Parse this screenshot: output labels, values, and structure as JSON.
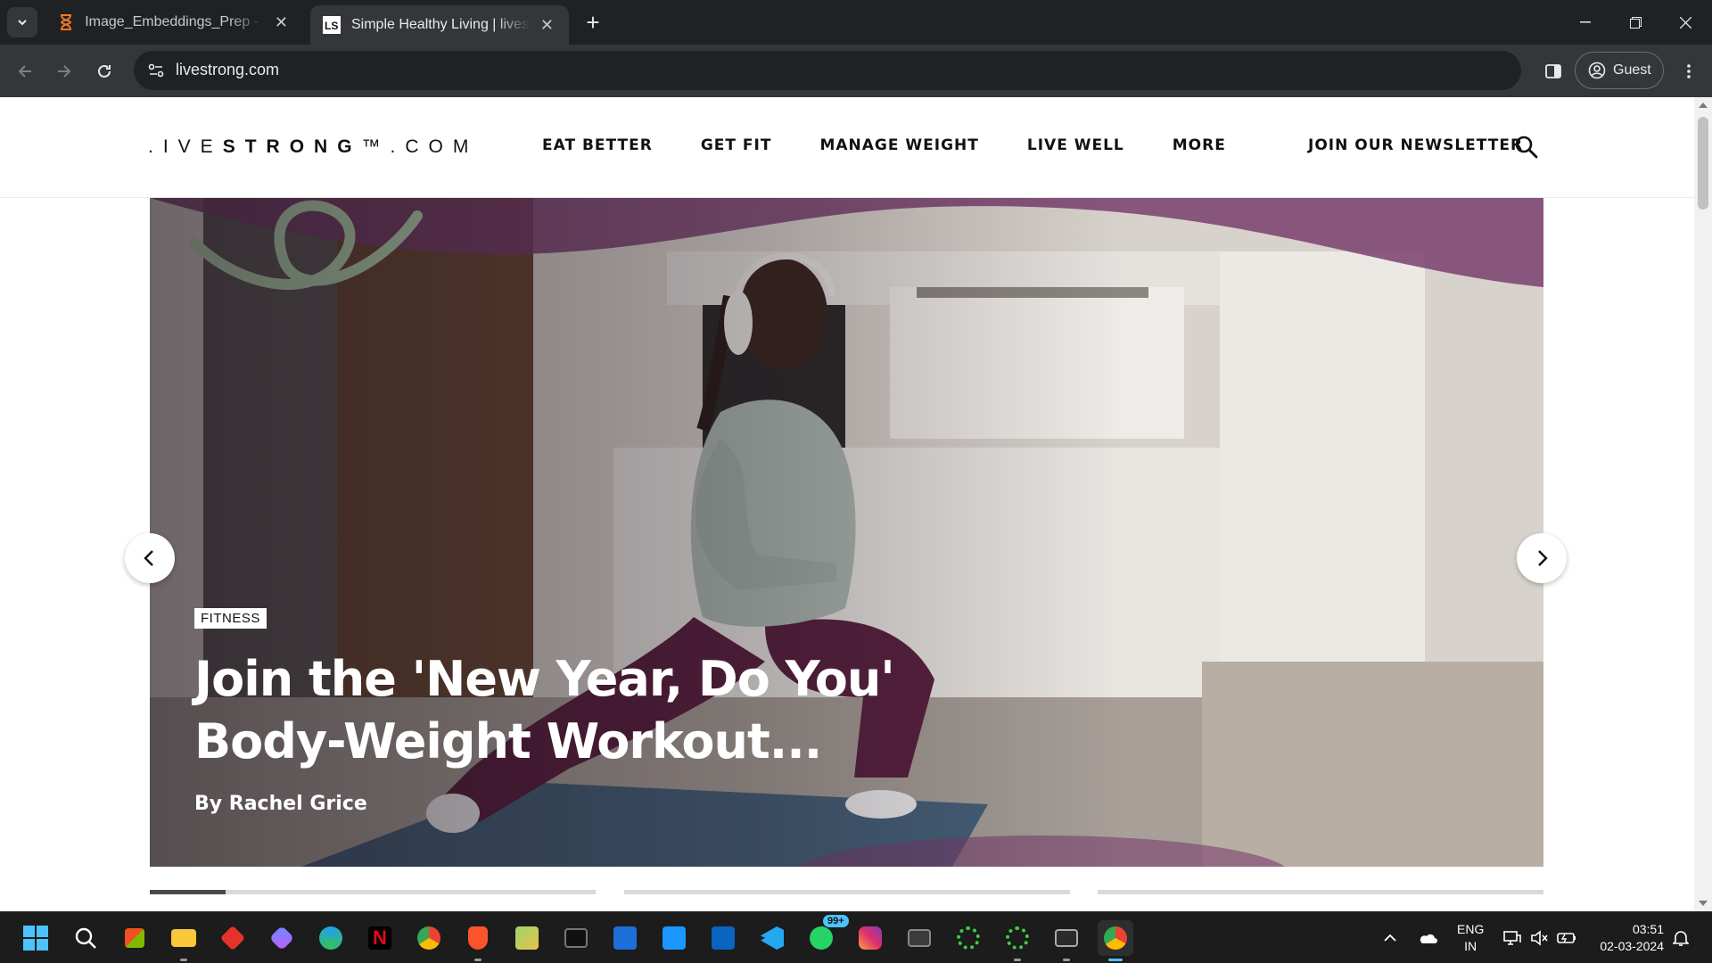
{
  "browser": {
    "tabs": [
      {
        "title": "Image_Embeddings_Prep - Jupyter",
        "active": false
      },
      {
        "title": "Simple Healthy Living | livestrong",
        "active": true
      }
    ],
    "url": "livestrong.com",
    "profile_label": "Guest"
  },
  "site": {
    "logo": {
      "pre": ".IVE",
      "bold": "STRONG",
      "post": "™.COM"
    },
    "nav": [
      "EAT BETTER",
      "GET FIT",
      "MANAGE WEIGHT",
      "LIVE WELL",
      "MORE"
    ],
    "newsletter_label": "JOIN OUR NEWSLETTER"
  },
  "hero": {
    "category": "FITNESS",
    "headline": "Join the 'New Year, Do You' Body-Weight Workout...",
    "byline": "By Rachel Grice",
    "slide_progress": [
      0.17,
      0,
      0
    ]
  },
  "taskbar": {
    "apps": [
      "start-icon",
      "search-icon",
      "store-icon",
      "file-explorer-icon",
      "app-red-icon",
      "copilot-icon",
      "edge-icon",
      "netflix-icon",
      "chrome-icon",
      "brave-icon",
      "photos-icon",
      "terminal-icon",
      "app-blue-icon",
      "prime-video-icon",
      "outlook-icon",
      "vscode-icon",
      "whatsapp-icon",
      "instagram-icon",
      "app-gray-icon",
      "ring-app-icon",
      "ring-app-2-icon",
      "powershell-icon",
      "chrome-active-icon"
    ],
    "whatsapp_badge": "99+",
    "lang_line1": "ENG",
    "lang_line2": "IN",
    "time": "03:51",
    "date": "02-03-2024"
  },
  "colors": {
    "accent": "#4cc2ff",
    "hero_plum": "#7a3f6e",
    "legging": "#5a2240"
  }
}
